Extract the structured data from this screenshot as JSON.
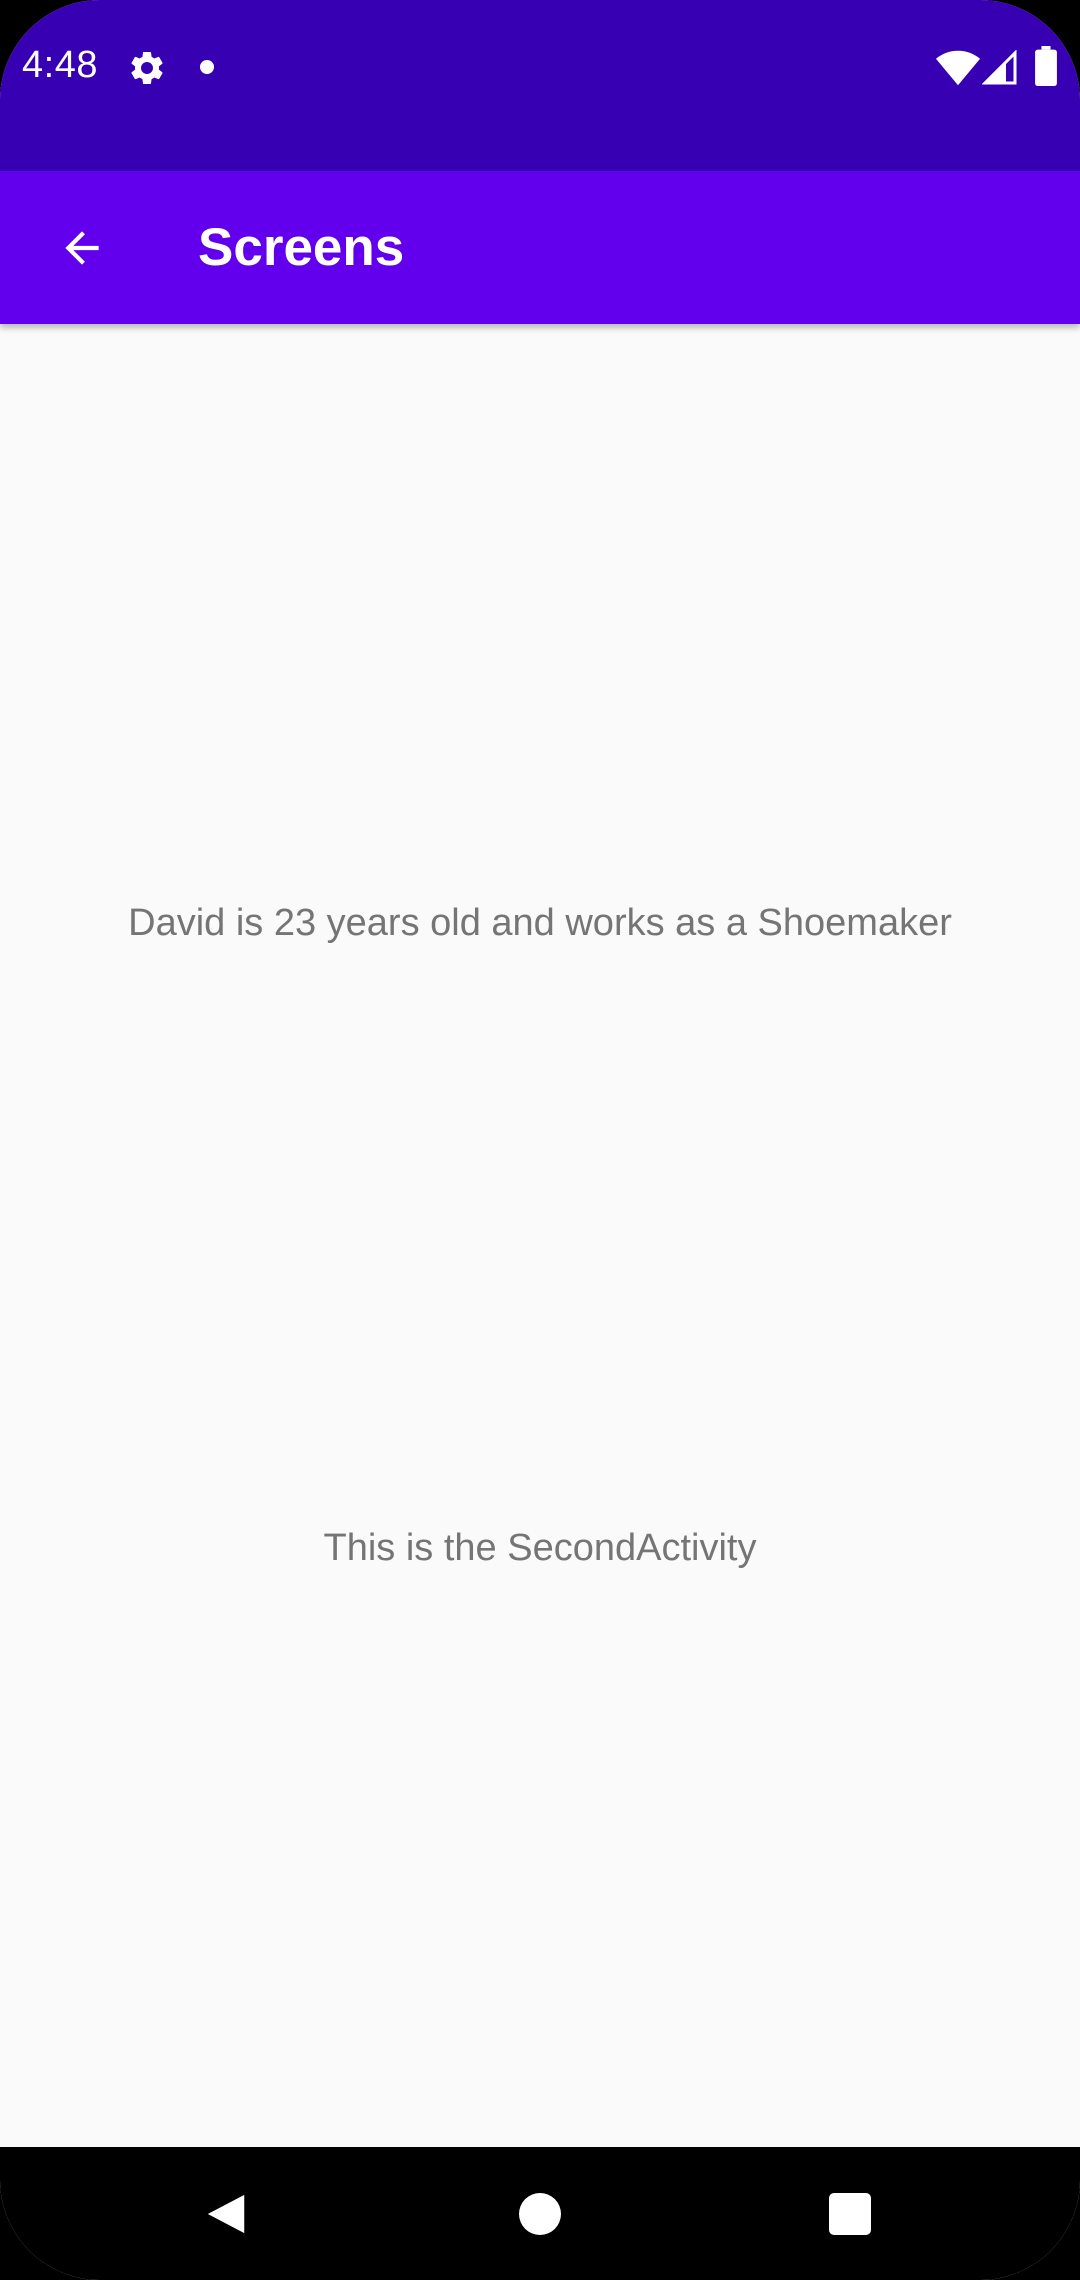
{
  "status_bar": {
    "time": "4:48",
    "icons": [
      "gear-icon",
      "notification-dot-icon",
      "wifi-icon",
      "signal-icon",
      "battery-icon"
    ],
    "background": "#3700b3"
  },
  "app_bar": {
    "title": "Screens",
    "back_icon": "arrow-left-icon",
    "background": "#6200ee"
  },
  "content": {
    "person_text": "David is 23 years old and works as a Shoemaker",
    "activity_text": "This is the SecondActivity",
    "background": "#fafafa"
  },
  "nav_bar": {
    "icons": [
      "nav-back-icon",
      "nav-home-icon",
      "nav-recents-icon"
    ]
  }
}
